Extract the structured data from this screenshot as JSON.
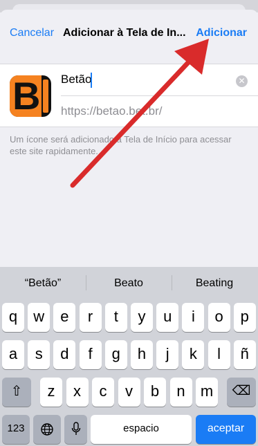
{
  "nav": {
    "cancel_label": "Cancelar",
    "title": "Adicionar à Tela de In...",
    "add_label": "Adicionar"
  },
  "form": {
    "name_value": "Betão",
    "url_value": "https://betao.bet.br/",
    "helper_text": "Um ícone será adicionado à Tela de Início para acessar este site rapidamente."
  },
  "keyboard": {
    "suggestions": [
      "“Betão”",
      "Beato",
      "Beating"
    ],
    "row1": [
      "q",
      "w",
      "e",
      "r",
      "t",
      "y",
      "u",
      "i",
      "o",
      "p"
    ],
    "row2": [
      "a",
      "s",
      "d",
      "f",
      "g",
      "h",
      "j",
      "k",
      "l",
      "ñ"
    ],
    "row3": [
      "z",
      "x",
      "c",
      "v",
      "b",
      "n",
      "m"
    ],
    "shift_icon": "⇧",
    "delete_icon": "⌫",
    "numbers_label": "123",
    "globe_icon": "🌐",
    "mic_icon": "🎤",
    "space_label": "espacio",
    "return_label": "aceptar"
  },
  "colors": {
    "accent": "#1a7cf5",
    "arrow": "#d92b2b",
    "icon_orange": "#f58220"
  }
}
